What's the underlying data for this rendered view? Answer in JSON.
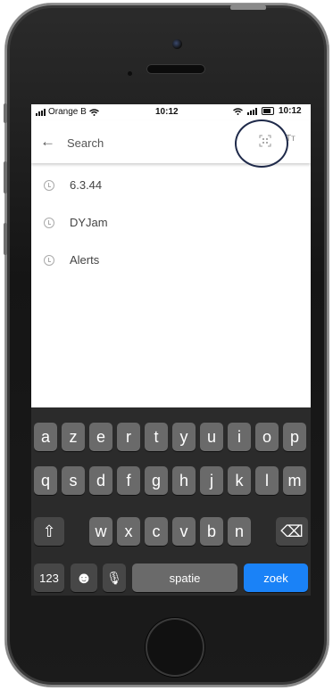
{
  "status_bar": {
    "carrier": "Orange B",
    "time_center": "10:12",
    "time_right": "10:12"
  },
  "search": {
    "placeholder": "Search",
    "icons": [
      "back-arrow-icon",
      "scan-icon",
      "text-size-icon"
    ],
    "text_size_label": "Tт"
  },
  "history": [
    {
      "label": "6.3.44"
    },
    {
      "label": "DYJam"
    },
    {
      "label": "Alerts"
    }
  ],
  "keyboard": {
    "row1": [
      "a",
      "z",
      "e",
      "r",
      "t",
      "y",
      "u",
      "i",
      "o",
      "p"
    ],
    "row2": [
      "q",
      "s",
      "d",
      "f",
      "g",
      "h",
      "j",
      "k",
      "l",
      "m"
    ],
    "row3": [
      "w",
      "x",
      "c",
      "v",
      "b",
      "n"
    ],
    "numbers_label": "123",
    "emoji_glyph": "☻",
    "mic_glyph": "🎙",
    "shift_glyph": "⇧",
    "delete_glyph": "⌫",
    "space_label": "spatie",
    "search_label": "zoek"
  },
  "colors": {
    "accent_blue": "#1a82f7",
    "highlight_ring": "#1f2a4a"
  }
}
